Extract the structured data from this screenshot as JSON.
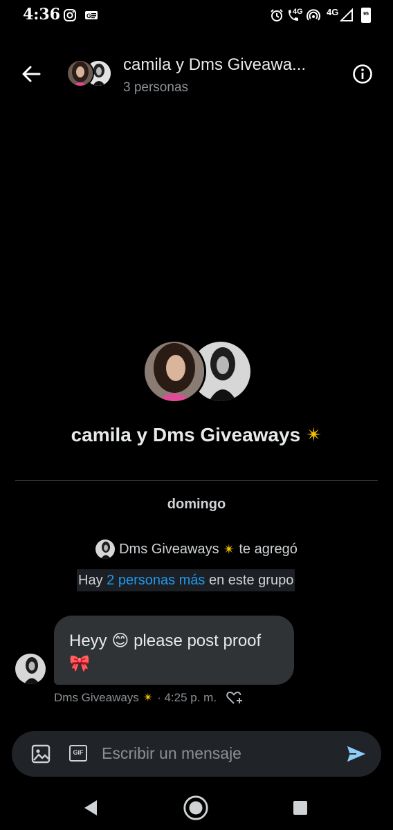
{
  "status_bar": {
    "time": "4:36",
    "network_left": "4G",
    "network_right": "4G",
    "battery": "95"
  },
  "header": {
    "title": "camila y Dms Giveawa...",
    "subtitle": "3 personas"
  },
  "conversation": {
    "group_name": "camila y Dms Giveaways",
    "group_emoji": "✴",
    "day_label": "domingo",
    "added_sender": "Dms Giveaways",
    "added_emoji": "✴",
    "added_text": "te agregó",
    "more_prefix": "Hay",
    "more_link": "2 personas más",
    "more_suffix": "en este grupo"
  },
  "message": {
    "text_part1": "Heyy",
    "emoji_smile": "😊",
    "text_part2": "please post proof",
    "emoji_bow": "🎀",
    "sender": "Dms Giveaways",
    "sender_emoji": "✴",
    "time": "· 4:25 p. m."
  },
  "composer": {
    "placeholder": "Escribir un mensaje",
    "gif_label": "GIF"
  },
  "colors": {
    "background": "#000000",
    "bubble": "#2f3336",
    "link": "#1d9bf0",
    "composer": "#202327",
    "send": "#8ecdf8"
  }
}
